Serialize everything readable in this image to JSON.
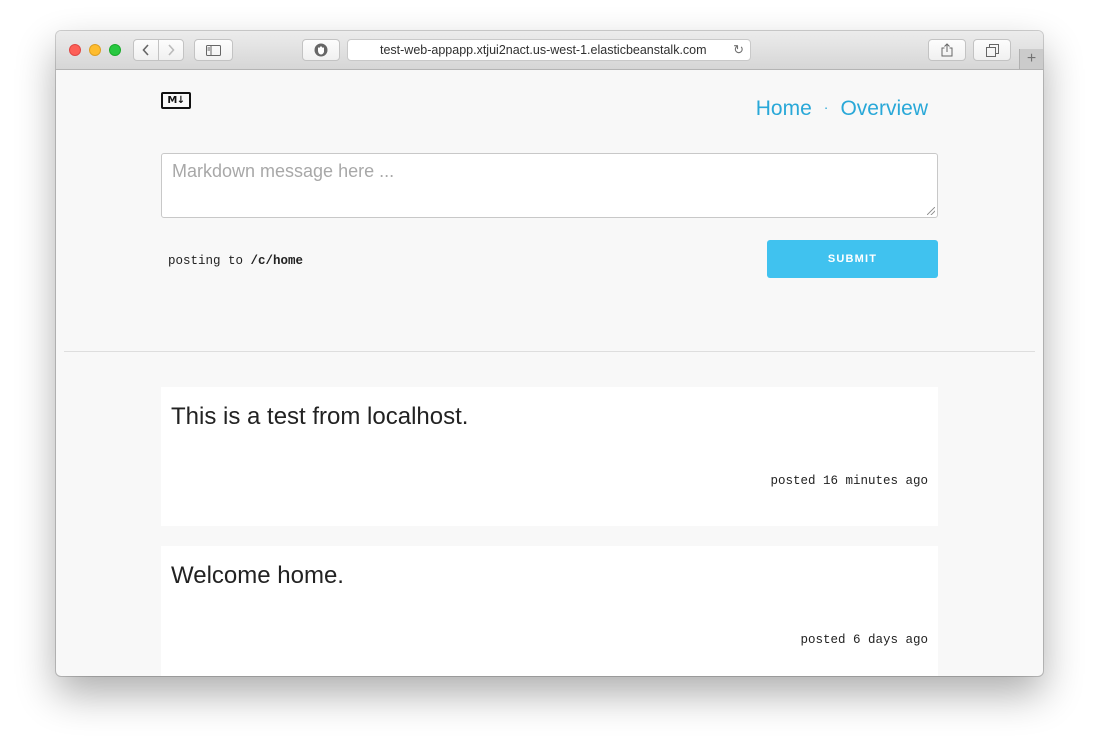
{
  "browser": {
    "url": "test-web-appapp.xtjui2nact.us-west-1.elasticbeanstalk.com",
    "new_tab_label": "+"
  },
  "site": {
    "logo_text": "M↓",
    "nav": [
      {
        "label": "Home"
      },
      {
        "label": "Overview"
      }
    ],
    "nav_separator": "·"
  },
  "composer": {
    "placeholder": "Markdown message here ...",
    "posting_prefix": "posting to",
    "posting_channel": "/c/home",
    "submit_label": "SUBMIT"
  },
  "posts": [
    {
      "text": "This is a test from localhost.",
      "meta": "posted 16 minutes ago"
    },
    {
      "text": "Welcome home.",
      "meta": "posted 6 days ago"
    }
  ],
  "colors": {
    "accent": "#29a8d8",
    "submit_bg": "#40c2ef"
  }
}
